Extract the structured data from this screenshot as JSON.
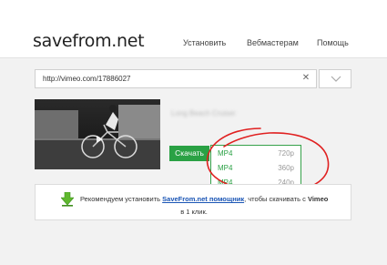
{
  "header": {
    "logo": "savefrom.net",
    "nav": {
      "install": "Установить",
      "webmasters": "Вебмастерам",
      "help": "Помощь"
    }
  },
  "search": {
    "url": "http://vimeo.com/17886027",
    "clear_icon": "close-icon",
    "dropdown_icon": "chevron-down-icon"
  },
  "result": {
    "title": "Long Beach Cruiser",
    "download_label": "Скачать",
    "formats": [
      {
        "format": "MP4",
        "quality": "720p"
      },
      {
        "format": "MP4",
        "quality": "360p"
      },
      {
        "format": "MP4",
        "quality": "240p"
      }
    ]
  },
  "notice": {
    "before": "Рекомендуем установить ",
    "link": "SaveFrom.net помощник",
    "middle": ", чтобы скачивать с ",
    "site": "Vimeo",
    "line2": "в 1 клик.",
    "icon": "green-download-arrow-icon"
  },
  "colors": {
    "accent_green": "#2aa144",
    "annotation_red": "#e02020",
    "link_blue": "#1a55b5"
  }
}
